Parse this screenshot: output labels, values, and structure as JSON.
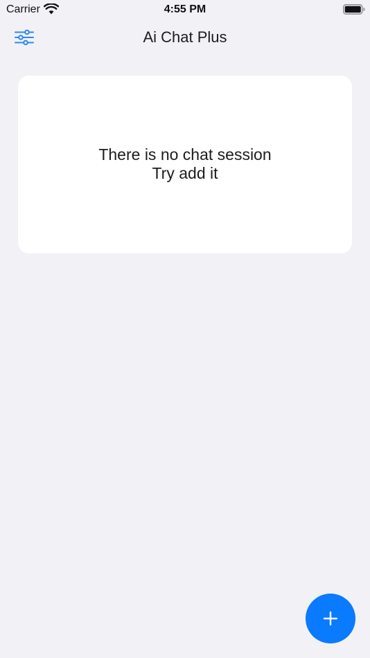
{
  "status_bar": {
    "carrier": "Carrier",
    "time": "4:55 PM",
    "wifi_icon": "wifi-icon",
    "battery_icon": "battery-full-icon"
  },
  "nav": {
    "title": "Ai Chat Plus",
    "filter_icon": "sliders-icon"
  },
  "empty_state": {
    "line1": "There is no chat session",
    "line2": "Try add it"
  },
  "fab": {
    "icon": "plus-icon"
  },
  "colors": {
    "background": "#f1f1f6",
    "card": "#ffffff",
    "accent": "#0a7afe",
    "text": "#1c1c1e"
  }
}
